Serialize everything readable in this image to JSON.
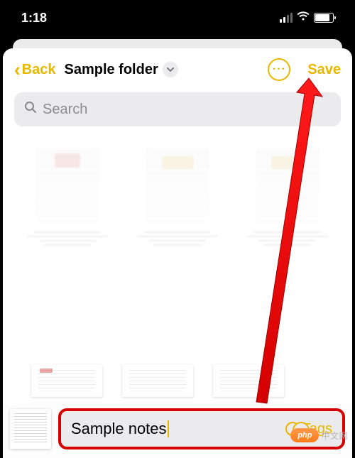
{
  "status": {
    "time": "1:18"
  },
  "nav": {
    "back_label": "Back",
    "folder_name": "Sample folder",
    "save_label": "Save"
  },
  "search": {
    "placeholder": "Search"
  },
  "titleInput": {
    "value": "Sample notes",
    "tags_label": "Tags"
  },
  "watermark": {
    "badge": "php",
    "text": "中文网"
  },
  "colors": {
    "accent": "#e6b800",
    "highlight_border": "#d40000"
  }
}
